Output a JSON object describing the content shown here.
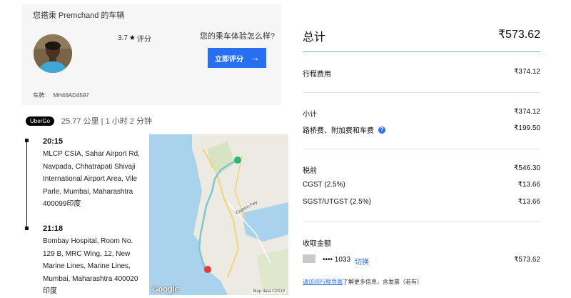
{
  "driver": {
    "title": "您搭乘 Premchand 的车辆",
    "rating": "3.7",
    "rating_suffix": "评分",
    "experience_question": "您的乘车体验怎么样?",
    "rate_button": "立即评分",
    "plate_label": "车牌:",
    "plate_number": "MH46AD4597"
  },
  "trip": {
    "badge": "UberGo",
    "summary": "25.77 公里 | 1 小时 2 分钟",
    "pickup": {
      "time": "20:15",
      "address": "MLCP CSIA, Sahar Airport Rd, Navpada, Chhatrapati Shivaji International Airport Area, Vile Parle, Mumbai, Maharashtra 400099印度"
    },
    "dropoff": {
      "time": "21:18",
      "address": "Bombay Hospital, Room No. 129 B, MRC Wing, 12, New Marine Lines, Marine Lines, Mumbai, Maharashtra 400020印度"
    }
  },
  "map": {
    "road_label": "Eastern Fwy",
    "google": "Google",
    "attribution": "Map data ©2019",
    "colors": {
      "water": "#a9d3ec",
      "land": "#eceae2",
      "route": "#7fc8c8",
      "start": "#2bb673",
      "end": "#e53935"
    }
  },
  "receipt": {
    "total_label": "总计",
    "total_value": "₹573.62",
    "rows": [
      {
        "label": "行程费用",
        "value": "₹374.12"
      },
      {
        "label": "小计",
        "value": "₹374.12"
      },
      {
        "label": "路桥费、附加费和车费",
        "value": "₹199.50"
      },
      {
        "label": "税前",
        "value": "₹546.30"
      },
      {
        "label": "CGST (2.5%)",
        "value": "₹13.66"
      },
      {
        "label": "SGST/UTGST (2.5%)",
        "value": "₹13.66"
      }
    ],
    "collect_label": "收取金额",
    "card_number": "•••• 1033",
    "switch_link": "切换",
    "collect_value": "₹573.62",
    "footer_link": "请访问行程页面",
    "footer_text": "了解更多信息，含发票（若有）"
  },
  "colors": {
    "accent": "#276ef1",
    "teal_rule": "#5ec1c1",
    "card_bg": "#f6f6f6"
  }
}
